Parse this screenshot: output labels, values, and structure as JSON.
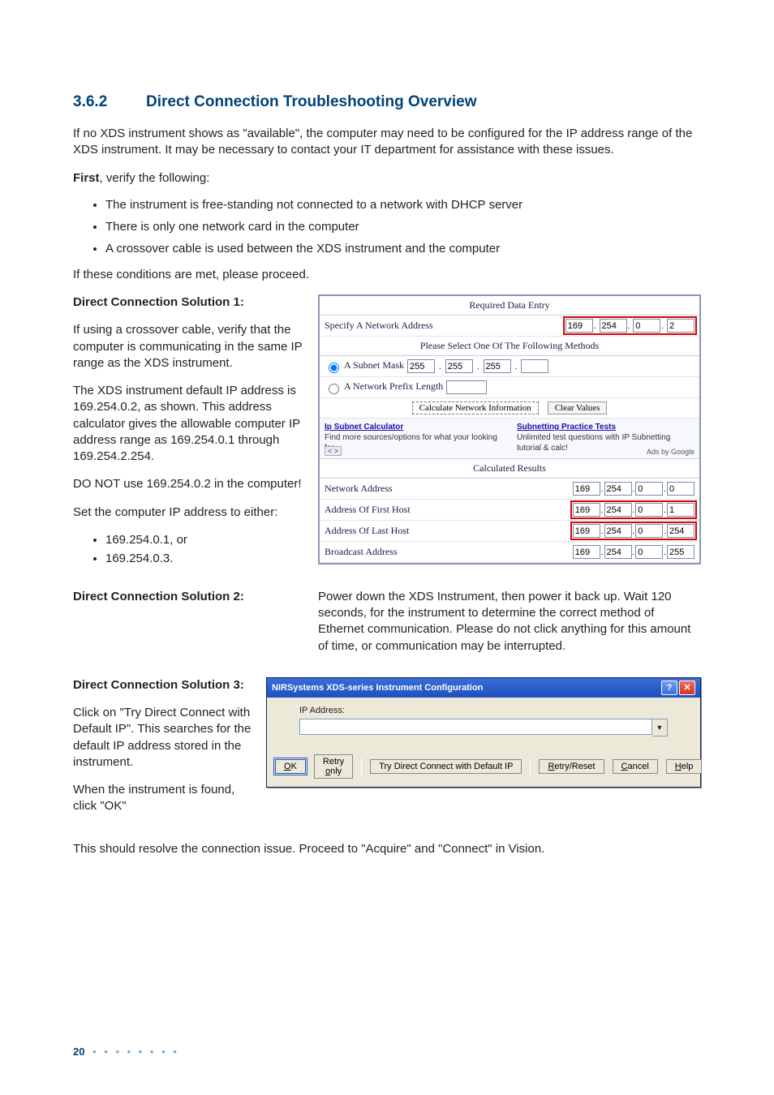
{
  "section": {
    "number": "3.6.2",
    "title": "Direct Connection Troubleshooting Overview"
  },
  "intro": "If no XDS instrument shows as \"available\", the computer may need to be configured for the IP address range of the XDS instrument. It may be necessary to contact your IT department for assistance with these issues.",
  "firstLabel": "First",
  "firstText": ", verify the following:",
  "verifyList": [
    "The instrument is free-standing not connected to a network with DHCP server",
    "There is only one network card in the computer",
    "A crossover cable is used between the XDS instrument and the computer"
  ],
  "proceed": "If these conditions are met, please proceed.",
  "sol1": {
    "heading": "Direct Connection Solution 1:",
    "p1": "If using a crossover cable, verify that the computer is communicating in the same IP range as the XDS instrument.",
    "p2": "The XDS instrument default IP address is 169.254.0.2, as shown. This address calculator gives the allowable computer IP address range as 169.254.0.1 through 169.254.2.254.",
    "p3": "DO NOT use 169.254.0.2 in the computer!",
    "p4": "Set the computer IP address to either:",
    "options": [
      "169.254.0.1, or",
      "169.254.0.3."
    ]
  },
  "calc": {
    "header": "Required Data Entry",
    "specifyLabel": "Specify A Network Address",
    "specify": [
      "169",
      "254",
      "0",
      "2"
    ],
    "selectMethod": "Please Select One Of The Following Methods",
    "subnetLabel": "A Subnet Mask",
    "subnet": [
      "255",
      "255",
      "255",
      ""
    ],
    "prefixLabel": "A Network Prefix Length",
    "prefix": "",
    "btnCalc": "Calculate Network Information",
    "btnClear": "Clear Values",
    "ad1Title": "Ip Subnet Calculator",
    "ad1Text": "Find more sources/options for what your looking for",
    "ad2Title": "Subnetting Practice Tests",
    "ad2Text": "Unlimited test questions with IP Subnetting tutorial & calc!",
    "adsBy": "Ads by Google",
    "resultsHeader": "Calculated Results",
    "rows": [
      {
        "label": "Network Address",
        "ip": [
          "169",
          "254",
          "0",
          "0"
        ],
        "hl": false
      },
      {
        "label": "Address Of First Host",
        "ip": [
          "169",
          "254",
          "0",
          "1"
        ],
        "hl": true
      },
      {
        "label": "Address Of Last Host",
        "ip": [
          "169",
          "254",
          "0",
          "254"
        ],
        "hl": true
      },
      {
        "label": "Broadcast Address",
        "ip": [
          "169",
          "254",
          "0",
          "255"
        ],
        "hl": false
      }
    ]
  },
  "sol2": {
    "heading": "Direct Connection Solution 2:",
    "text": "Power down the XDS Instrument, then power it back up. Wait 120 seconds, for the instrument to determine the correct method of Ethernet communication. Please do not click anything for this amount of time, or communication may be interrupted."
  },
  "sol3": {
    "heading": "Direct Connection Solution 3:",
    "p1": "Click on \"Try Direct Connect with Default IP\". This searches for the default IP address stored in the instrument.",
    "p2": "When the instrument is found, click \"OK\""
  },
  "dialog": {
    "title": "NIRSystems XDS-series Instrument Configuration",
    "ipLabel": "IP Address:",
    "ipValue": "",
    "buttons": {
      "ok": "OK",
      "retryOnly": "Retry only",
      "tryDirect": "Try Direct Connect with Default IP",
      "retryReset": "Retry/Reset",
      "cancel": "Cancel",
      "help": "Help"
    }
  },
  "closing": "This should resolve the connection issue. Proceed to \"Acquire\" and \"Connect\" in Vision.",
  "pageNumber": "20"
}
